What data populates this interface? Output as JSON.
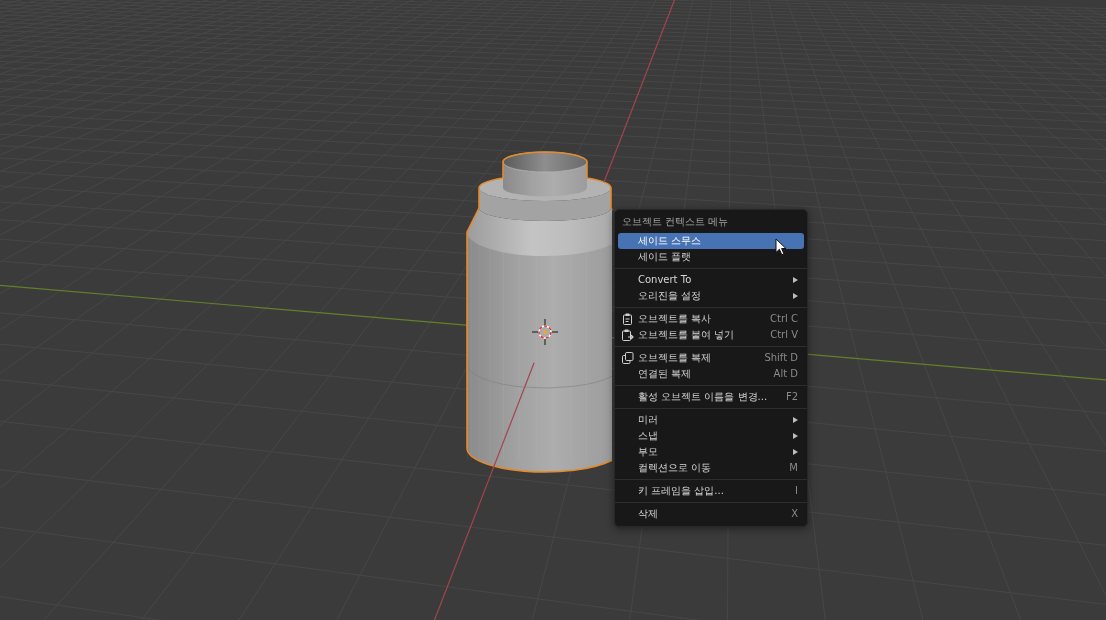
{
  "scene": {
    "object": {
      "selected": true
    }
  },
  "context_menu": {
    "title": "오브젝트 컨텍스트 메뉴",
    "groups": [
      {
        "items": [
          {
            "label": "세이드 스무스",
            "kind": "command",
            "selected": true
          },
          {
            "label": "세이드 플랫",
            "kind": "command",
            "selected": false
          }
        ]
      },
      {
        "items": [
          {
            "label": "Convert To",
            "kind": "submenu",
            "selected": false
          },
          {
            "label": "오리진을 설정",
            "kind": "submenu",
            "selected": false
          }
        ]
      },
      {
        "items": [
          {
            "label": "오브젝트를 복사",
            "kind": "copy",
            "shortcut": "Ctrl C",
            "selected": false
          },
          {
            "label": "오브젝트를 붙여 넣기",
            "kind": "paste",
            "shortcut": "Ctrl V",
            "selected": false
          }
        ]
      },
      {
        "items": [
          {
            "label": "오브젝트를 복제",
            "kind": "duplicate",
            "shortcut": "Shift D",
            "selected": false
          },
          {
            "label": "연결된 복제",
            "kind": "command",
            "shortcut": "Alt D",
            "selected": false
          }
        ]
      },
      {
        "items": [
          {
            "label": "활성 오브젝트 이름을 변경...",
            "kind": "command",
            "shortcut": "F2",
            "selected": false
          }
        ]
      },
      {
        "items": [
          {
            "label": "미러",
            "kind": "submenu",
            "selected": false
          },
          {
            "label": "스냅",
            "kind": "submenu",
            "selected": false
          },
          {
            "label": "부모",
            "kind": "submenu",
            "selected": false
          },
          {
            "label": "컬렉션으로 이동",
            "kind": "command",
            "shortcut": "M",
            "selected": false
          }
        ]
      },
      {
        "items": [
          {
            "label": "키 프레임을 삽입...",
            "kind": "command",
            "shortcut": "I",
            "selected": false
          }
        ]
      },
      {
        "items": [
          {
            "label": "삭제",
            "kind": "command",
            "shortcut": "X",
            "selected": false
          }
        ]
      }
    ]
  }
}
